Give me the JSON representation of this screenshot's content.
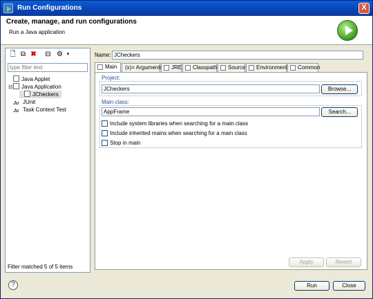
{
  "window": {
    "title": "Run Configurations",
    "close_glyph": "X"
  },
  "header": {
    "title": "Create, manage, and run configurations",
    "subtitle": "Run a Java application",
    "icon": "run-icon"
  },
  "left": {
    "filter_placeholder": "type filter text",
    "tree": [
      {
        "label": "Java Applet"
      },
      {
        "label": "Java Application",
        "expander": "⊟"
      },
      {
        "label": "JCheckers"
      },
      {
        "label": "JUnit"
      },
      {
        "label": "Task Context Test"
      }
    ],
    "status": "Filter matched 5 of 5 items"
  },
  "right": {
    "name_label": "Name:",
    "name_value": "JCheckers",
    "tabs": [
      {
        "label": "Main"
      },
      {
        "label": "Arguments",
        "prefix": "(x)="
      },
      {
        "label": "JRE"
      },
      {
        "label": "Classpath"
      },
      {
        "label": "Source"
      },
      {
        "label": "Environment"
      },
      {
        "label": "Common"
      }
    ],
    "project_label": "Project:",
    "project_value": "JCheckers",
    "browse_label": "Browse...",
    "main_class_label": "Main class:",
    "main_class_value": "AppFrame",
    "search_label": "Search...",
    "checkboxes": [
      "Include system libraries when searching for a main class",
      "Include inherited mains when searching for a main class",
      "Stop in main"
    ],
    "apply_label": "Apply",
    "revert_label": "Revert"
  },
  "footer": {
    "run_label": "Run",
    "close_label": "Close",
    "help_glyph": "?"
  }
}
